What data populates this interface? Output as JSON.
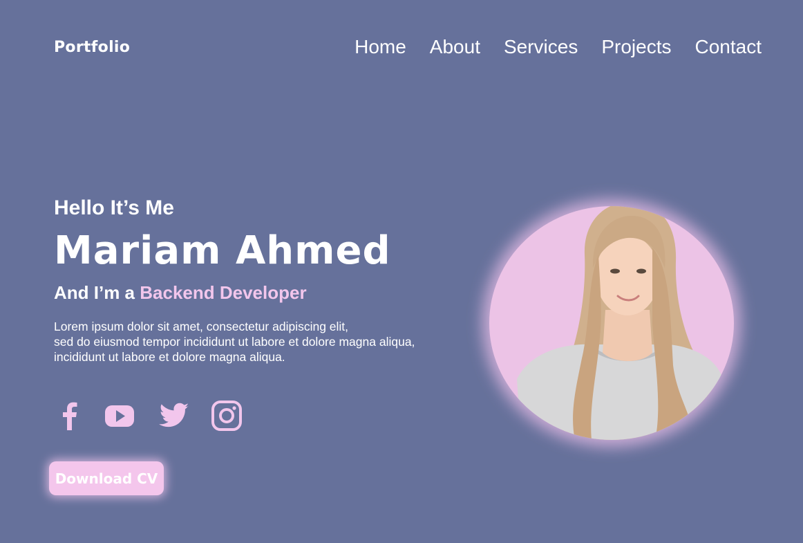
{
  "header": {
    "logo": "Portfolio",
    "nav": [
      {
        "label": "Home"
      },
      {
        "label": "About"
      },
      {
        "label": "Services"
      },
      {
        "label": "Projects"
      },
      {
        "label": "Contact"
      }
    ]
  },
  "hero": {
    "greeting": "Hello It’s Me",
    "name": "Mariam Ahmed",
    "role_prefix": "And I’m a",
    "role_accent": "Backend Developer",
    "description_lines": [
      "Lorem ipsum dolor sit amet, consectetur adipiscing elit,",
      "sed do eiusmod tempor incididunt ut labore et dolore magna aliqua,",
      "incididunt ut labore et dolore magna aliqua."
    ],
    "socials": [
      {
        "icon": "facebook-icon"
      },
      {
        "icon": "youtube-icon"
      },
      {
        "icon": "twitter-icon"
      },
      {
        "icon": "instagram-icon"
      }
    ],
    "cta_label": "Download CV",
    "portrait_icon": "profile-photo"
  },
  "colors": {
    "background": "#66719b",
    "accent": "#f2c6ec",
    "text": "#ffffff"
  }
}
